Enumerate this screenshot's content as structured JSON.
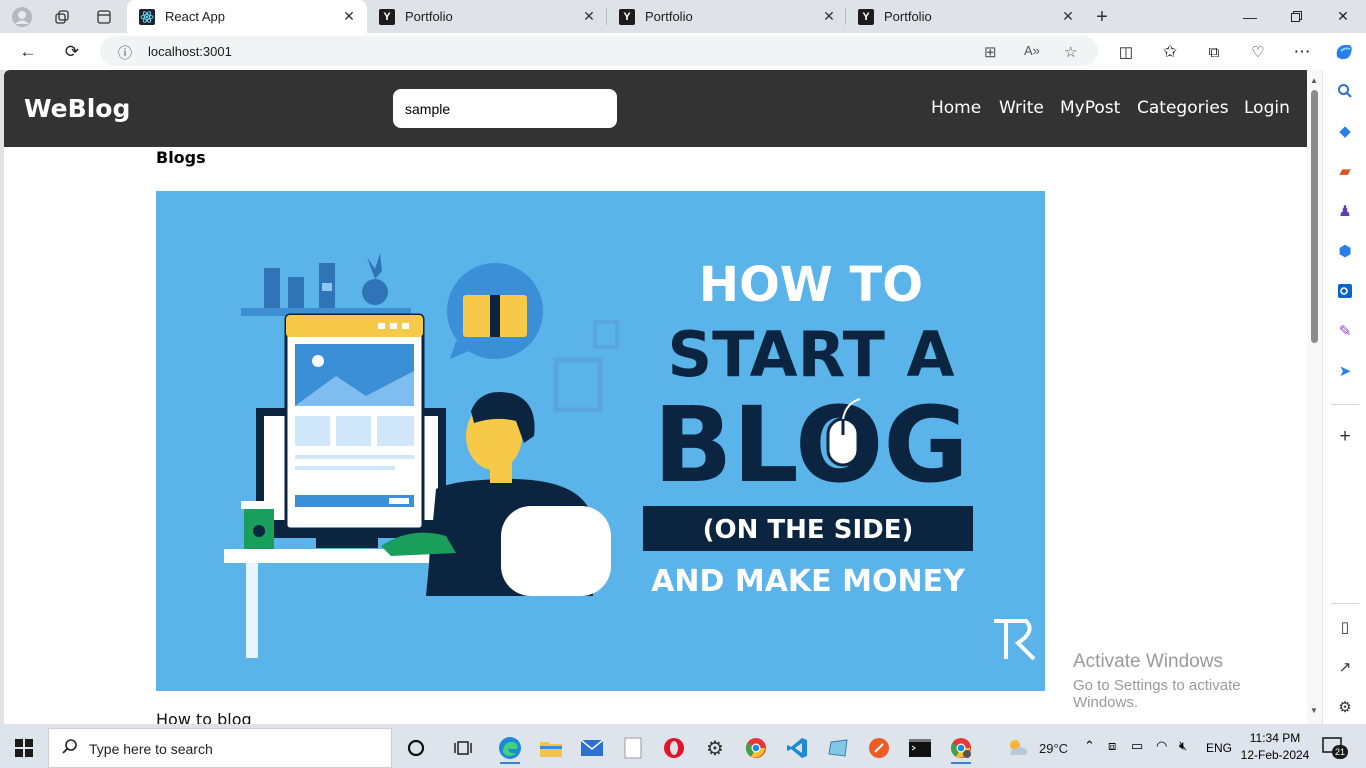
{
  "browser": {
    "tabs": [
      {
        "title": "React App",
        "favicon": "react-icon",
        "active": true
      },
      {
        "title": "Portfolio",
        "favicon": "y-icon",
        "active": false
      },
      {
        "title": "Portfolio",
        "favicon": "y-icon",
        "active": false
      },
      {
        "title": "Portfolio",
        "favicon": "y-icon",
        "active": false
      }
    ],
    "url": "localhost:3001"
  },
  "site": {
    "brand": "WeBlog",
    "search_value": "sample",
    "nav": [
      "Home",
      "Write",
      "MyPost",
      "Categories",
      "Login"
    ],
    "section_heading": "Blogs",
    "post": {
      "title": "How to blog",
      "image_text": {
        "line1": "HOW TO",
        "line2": "START A",
        "line3": "BLOG",
        "line4": "(ON THE SIDE)",
        "line5": "AND MAKE MONEY"
      }
    }
  },
  "watermark": {
    "line1": "Activate Windows",
    "line2": "Go to Settings to activate Windows."
  },
  "taskbar": {
    "search_placeholder": "Type here to search",
    "weather": "29°C",
    "language": "ENG",
    "time": "11:34 PM",
    "date": "12-Feb-2024",
    "notifications": "21"
  },
  "colors": {
    "navbar": "#333333",
    "hero_bg": "#5ab4ea",
    "hero_dark": "#0b2540"
  }
}
